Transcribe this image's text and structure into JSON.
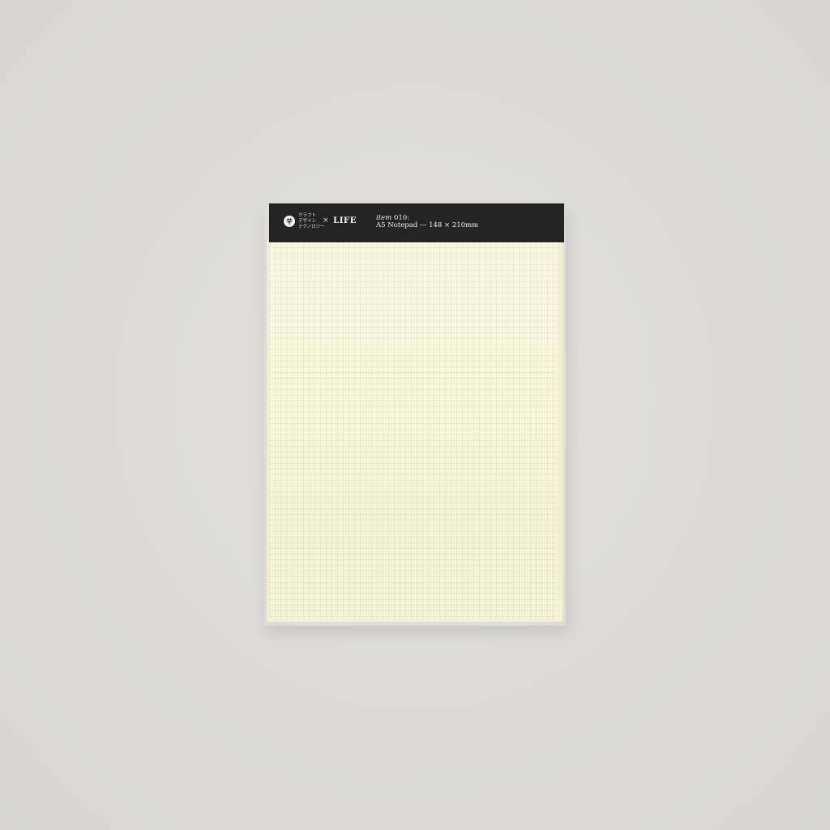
{
  "scene": {
    "background_color": "#dcdbd7",
    "object": "A5 notepad with black header strip and cream grid paper"
  },
  "header": {
    "color": "#232323",
    "logo_icon": "ct-circle-logo-icon",
    "jp_line_1": "クラフト",
    "jp_line_2": "デザイン",
    "jp_line_3": "テクノロジー",
    "times_symbol": "×",
    "brand": "LIFE",
    "item_prefix": "item",
    "item_number": "010:",
    "description": "A5 Notepad — 148 × 210mm"
  },
  "sheet": {
    "color": "#f6f4d6",
    "pattern": "grid"
  }
}
